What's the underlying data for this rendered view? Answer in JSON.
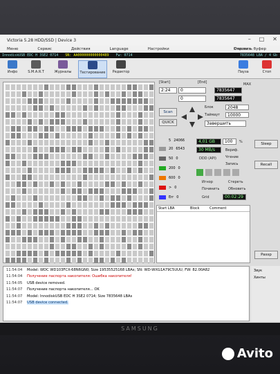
{
  "window": {
    "title": "Victoria 5.28 HDD/SSD | Device 3"
  },
  "menu": [
    "Меню",
    "Сервис",
    "Действия",
    "Language",
    "Настройки"
  ],
  "menu_right": "Справка",
  "menu_clear": "Очистить буфер",
  "status": {
    "drive": "InnodiskUSB EDC H 3SE2  0714",
    "sn": "SN: AA000000000000489",
    "fw": "Fw: 0714",
    "lba": "7835648 LBA / 4 Gb"
  },
  "toolbar": {
    "buttons": [
      "Инфо",
      "S.M.A.R.T",
      "Журналы",
      "Тестирование",
      "Редактор"
    ],
    "active": "Тестирование",
    "pause": "Пауза",
    "stop": "Стоп"
  },
  "test": {
    "start_label": "[Start]",
    "end_label": "[End]",
    "start_value": "0",
    "end_value": "7835647",
    "end_value2": "7835647",
    "time": "2:24",
    "block_label": "Блок",
    "block_size": "2048",
    "timeout_label": "Таймаут",
    "timeout_value": "10000",
    "scan_btn": "Scan",
    "quick_btn": "QUICK",
    "mode": "Завершить",
    "max_label": "MAX"
  },
  "legend": [
    {
      "label": "5",
      "value": "24066"
    },
    {
      "label": "20",
      "value": "6543"
    },
    {
      "label": "50",
      "value": "0"
    },
    {
      "label": "200",
      "value": "0"
    },
    {
      "label": "600",
      "value": "0"
    },
    {
      "label": ">",
      "value": "0"
    },
    {
      "label": "Err",
      "value": "0"
    }
  ],
  "progress": {
    "size": "4,01 GB",
    "percent": "100",
    "unit": "%",
    "speed": "30 MB/s"
  },
  "options": {
    "verify": "Вериф.",
    "read": "Чтение",
    "write": "Запись",
    "ddd": "DDD (API)",
    "ignore": "Игнор",
    "erase": "Стереть",
    "remap": "Починить",
    "refresh": "Обновить",
    "grid": "Grid",
    "grid_time": "00:02:29"
  },
  "table": {
    "headers": [
      "Start LBA",
      "Block",
      "Comment"
    ]
  },
  "right_panel": {
    "sleep": "Sleep",
    "recall": "Recall",
    "passp": "Passp"
  },
  "log": [
    {
      "time": "11:54:04",
      "msg": "Model: WDC WD103FCX-68N6GN0; Size 19535525168 LBAs; SN: WD-WXG1A79C5UUU; FW: 82.00A82",
      "type": "normal"
    },
    {
      "time": "11:54:04",
      "msg": "Получение паспорта накопителя: Ошибка накопителя!",
      "type": "err"
    },
    {
      "time": "11:54:05",
      "msg": "USB device removed.",
      "type": "normal"
    },
    {
      "time": "11:54:07",
      "msg": "Получение паспорта накопителя... OK",
      "type": "normal"
    },
    {
      "time": "11:54:07",
      "msg": "Model: InnodiskUSB EDC H 3SE2  0714; Size 7835648 LBAs",
      "type": "normal"
    },
    {
      "time": "11:54:07",
      "msg": "USB device connected.",
      "type": "blue"
    }
  ],
  "log_right": {
    "sound": "Звук",
    "hints": "Хинты"
  },
  "bezel_brand": "SAMSUNG",
  "watermark": "Avito"
}
